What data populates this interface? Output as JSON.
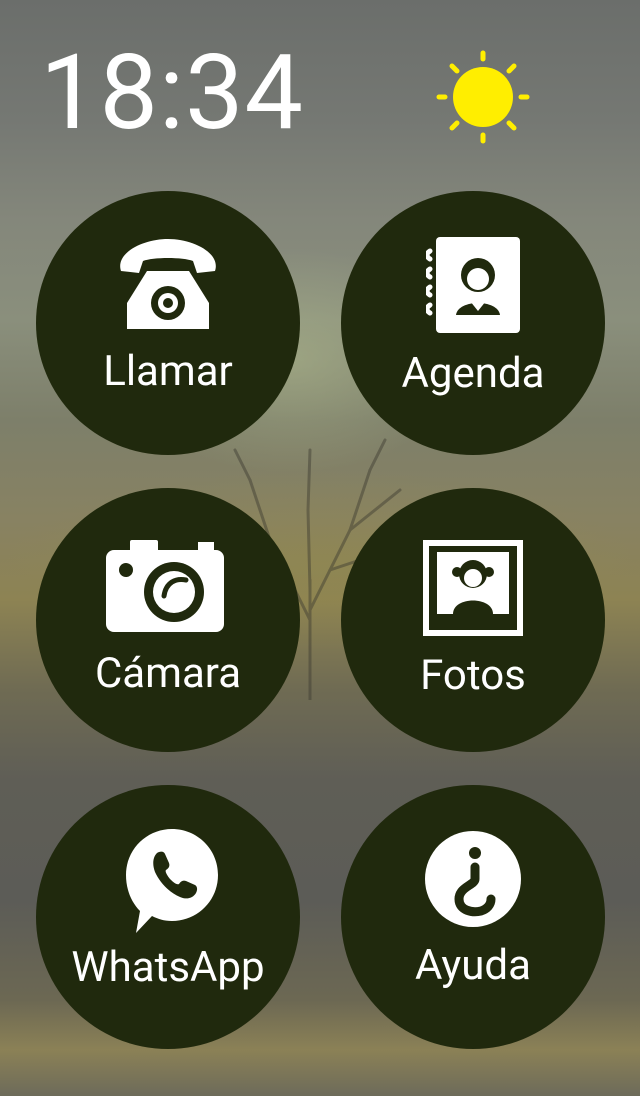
{
  "status": {
    "time": "18:34",
    "weather_icon": "sun-icon",
    "weather_color": "#ffee00"
  },
  "theme": {
    "tile_color": "#20290d",
    "text_color": "#ffffff"
  },
  "apps": [
    {
      "label": "Llamar",
      "icon": "telephone-icon"
    },
    {
      "label": "Agenda",
      "icon": "contacts-book-icon"
    },
    {
      "label": "Cámara",
      "icon": "camera-icon"
    },
    {
      "label": "Fotos",
      "icon": "photo-icon"
    },
    {
      "label": "WhatsApp",
      "icon": "whatsapp-icon"
    },
    {
      "label": "Ayuda",
      "icon": "help-icon"
    }
  ]
}
